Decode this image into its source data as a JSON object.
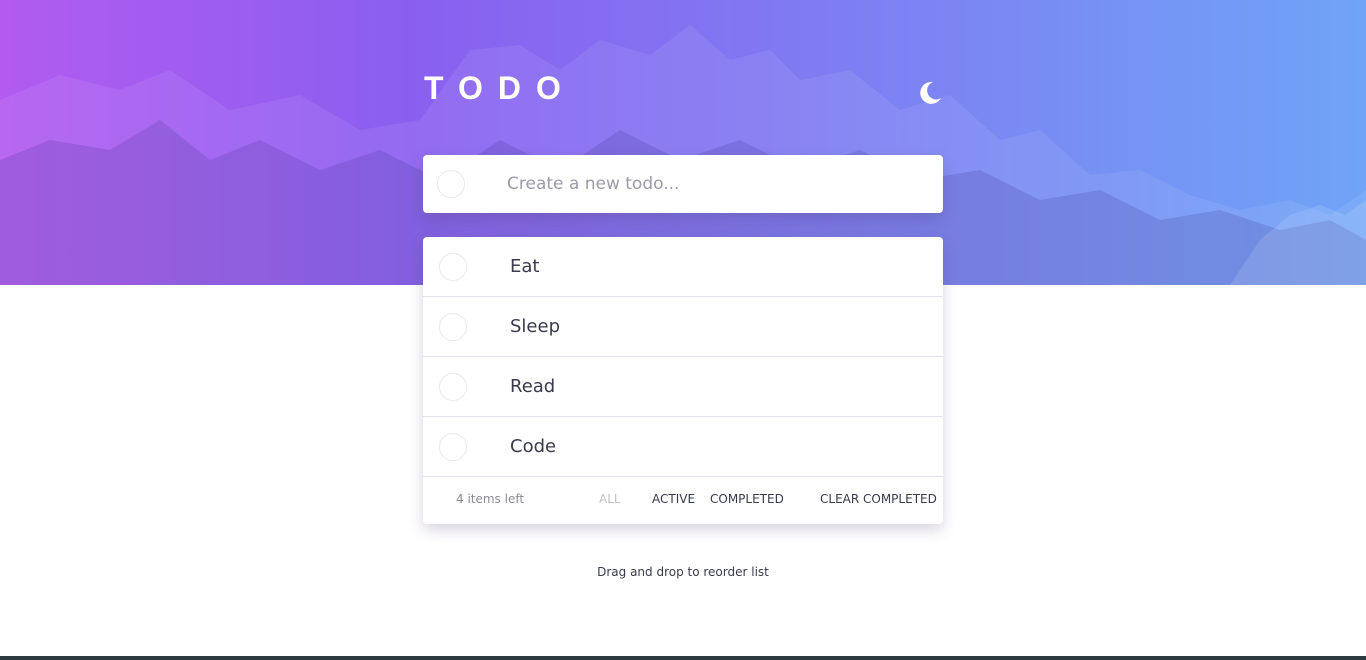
{
  "app": {
    "title": "TODO",
    "theme_toggle_icon": "moon-icon"
  },
  "new_todo": {
    "placeholder": "Create a new todo..."
  },
  "todos": [
    {
      "text": "Eat",
      "completed": false
    },
    {
      "text": "Sleep",
      "completed": false
    },
    {
      "text": "Read",
      "completed": false
    },
    {
      "text": "Code",
      "completed": false
    }
  ],
  "footer": {
    "items_left": "4 items left",
    "filters": {
      "all": "ALL",
      "active": "ACTIVE",
      "completed": "COMPLETED"
    },
    "selected_filter": "all",
    "clear_completed": "CLEAR COMPLETED"
  },
  "hint": "Drag and drop to reorder list",
  "colors": {
    "gradient_start": "#b25bf0",
    "gradient_end": "#6fa4f7",
    "text": "#393a4b",
    "muted": "#8b8b98"
  }
}
